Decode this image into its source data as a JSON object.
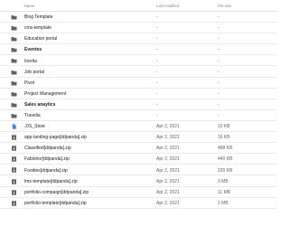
{
  "columns": {
    "name": "Name",
    "modified": "Last modified",
    "size": "File size"
  },
  "colors": {
    "folder": "#5f6368",
    "doc": "#4285f4",
    "zip": "#5f6368",
    "divider": "#ececec"
  },
  "rows": [
    {
      "icon": "folder-icon",
      "name": "Blog Template",
      "modified": "-",
      "size": "-",
      "bold": false
    },
    {
      "icon": "folder-icon",
      "name": "cms-template",
      "modified": "-",
      "size": "-",
      "bold": false
    },
    {
      "icon": "folder-icon",
      "name": "Education portal",
      "modified": "-",
      "size": "-",
      "bold": false
    },
    {
      "icon": "folder-icon",
      "name": "Eventes",
      "modified": "-",
      "size": "-",
      "bold": true
    },
    {
      "icon": "folder-icon",
      "name": "Inertia",
      "modified": "-",
      "size": "-",
      "bold": false
    },
    {
      "icon": "folder-icon",
      "name": "Job portal",
      "modified": "-",
      "size": "-",
      "bold": false
    },
    {
      "icon": "folder-icon",
      "name": "Pivot",
      "modified": "-",
      "size": "-",
      "bold": false
    },
    {
      "icon": "folder-icon",
      "name": "Project Management",
      "modified": "-",
      "size": "-",
      "bold": false
    },
    {
      "icon": "folder-icon",
      "name": "Sales anaytics",
      "modified": "-",
      "size": "-",
      "bold": true
    },
    {
      "icon": "folder-icon",
      "name": "Travelia",
      "modified": "-",
      "size": "-",
      "bold": false
    },
    {
      "icon": "document-icon",
      "name": ".DS_Store",
      "modified": "Apr 2, 2021",
      "size": "10 KB",
      "bold": false
    },
    {
      "icon": "zip-icon",
      "name": "app-landing-page[ddpanda].zip",
      "modified": "Apr 2, 2021",
      "size": "16 KB",
      "bold": false
    },
    {
      "icon": "zip-icon",
      "name": "Classified[ddpanda].zip",
      "modified": "Apr 2, 2021",
      "size": "488 KB",
      "bold": false
    },
    {
      "icon": "zip-icon",
      "name": "Fabiorior[ddpanda].zip",
      "modified": "Apr 2, 2021",
      "size": "440 KB",
      "bold": false
    },
    {
      "icon": "zip-icon",
      "name": "Foodies[ddpanda].zip",
      "modified": "Apr 2, 2021",
      "size": "220 KB",
      "bold": false
    },
    {
      "icon": "zip-icon",
      "name": "lms-template[ddpanda].zip",
      "modified": "Apr 2, 2021",
      "size": "3 MB",
      "bold": false
    },
    {
      "icon": "zip-icon",
      "name": "portfolio-compaign[ddpanda].zip",
      "modified": "Apr 2, 2021",
      "size": "11 MB",
      "bold": false
    },
    {
      "icon": "zip-icon",
      "name": "portfolio-template[ddpanda].zip",
      "modified": "Apr 2, 2021",
      "size": "1 MB",
      "bold": false
    }
  ]
}
